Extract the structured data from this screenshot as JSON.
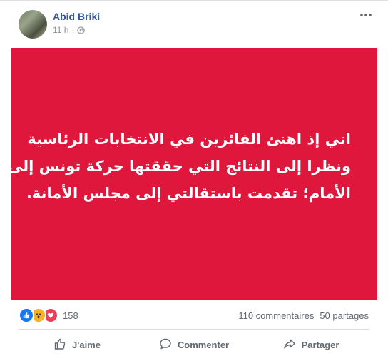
{
  "post": {
    "author": "Abid Briki",
    "time": "11 h",
    "separator": "·",
    "text_lines": [
      "اني إذ اهنئ الفائزين في الانتخابات الرئاسية",
      "ونظرا إلى النتائج التي حققتها حركة تونس إلى",
      "الأمام؛ تقدمت باستقالتي إلى مجلس الأمانة."
    ],
    "image_bg_color": "#e0173c"
  },
  "stats": {
    "reactions_count": "158",
    "comments": "110 commentaires",
    "shares": "50 partages"
  },
  "actions": {
    "like": "J'aime",
    "comment": "Commenter",
    "share": "Partager"
  },
  "icons": {
    "privacy": "globe-icon",
    "more": "more-horizontal-icon",
    "like": "thumbs-up-icon",
    "comment": "comment-bubble-icon",
    "share": "share-arrow-icon"
  }
}
